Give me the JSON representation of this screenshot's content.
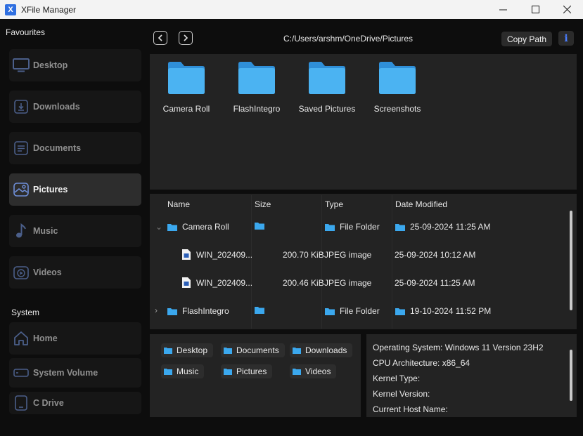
{
  "window": {
    "title": "XFile Manager",
    "logo_text": "X"
  },
  "sidebar": {
    "favourites_title": "Favourites",
    "favourites": [
      {
        "label": "Desktop",
        "icon": "monitor-icon"
      },
      {
        "label": "Downloads",
        "icon": "download-icon"
      },
      {
        "label": "Documents",
        "icon": "document-icon"
      },
      {
        "label": "Pictures",
        "icon": "image-icon",
        "active": true
      },
      {
        "label": "Music",
        "icon": "music-note-icon"
      },
      {
        "label": "Videos",
        "icon": "video-icon"
      }
    ],
    "system_title": "System",
    "system": [
      {
        "label": "Home",
        "icon": "home-icon"
      },
      {
        "label": "System Volume",
        "icon": "drive-icon"
      },
      {
        "label": "C Drive",
        "icon": "tablet-icon"
      }
    ]
  },
  "pathbar": {
    "path": "C:/Users/arshm/OneDrive/Pictures",
    "copy_label": "Copy Path",
    "info_label": "i"
  },
  "grid": {
    "folders": [
      "Camera Roll",
      "FlashIntegro",
      "Saved Pictures",
      "Screenshots"
    ]
  },
  "table": {
    "headers": {
      "name": "Name",
      "size": "Size",
      "type": "Type",
      "modified": "Date Modified"
    },
    "rows": [
      {
        "name": "Camera Roll",
        "size": "",
        "type": "File Folder",
        "modified": "25-09-2024 11:25 AM",
        "kind": "folder",
        "expander": "⌄"
      },
      {
        "name": "WIN_202409...",
        "size": "200.70 KiB",
        "type": "JPEG image",
        "modified": "25-09-2024 10:12 AM",
        "kind": "file"
      },
      {
        "name": "WIN_202409...",
        "size": "200.46 KiB",
        "type": "JPEG image",
        "modified": "25-09-2024 11:25 AM",
        "kind": "file"
      },
      {
        "name": "FlashIntegro",
        "size": "",
        "type": "File Folder",
        "modified": "19-10-2024 11:52 PM",
        "kind": "folder",
        "expander": "›"
      }
    ]
  },
  "quick_access": [
    "Desktop",
    "Documents",
    "Downloads",
    "Music",
    "Pictures",
    "Videos"
  ],
  "system_info": {
    "os": "Operating System: Windows 11 Version 23H2",
    "cpu": "CPU Architecture: x86_64",
    "kernel_type": "Kernel Type:",
    "kernel_version": "Kernel Version:",
    "host": "Current Host Name:"
  },
  "colors": {
    "folder_blue": "#3ba8ee",
    "accent_blue": "#4a7dff",
    "icon_muted": "#4b5f8a"
  }
}
